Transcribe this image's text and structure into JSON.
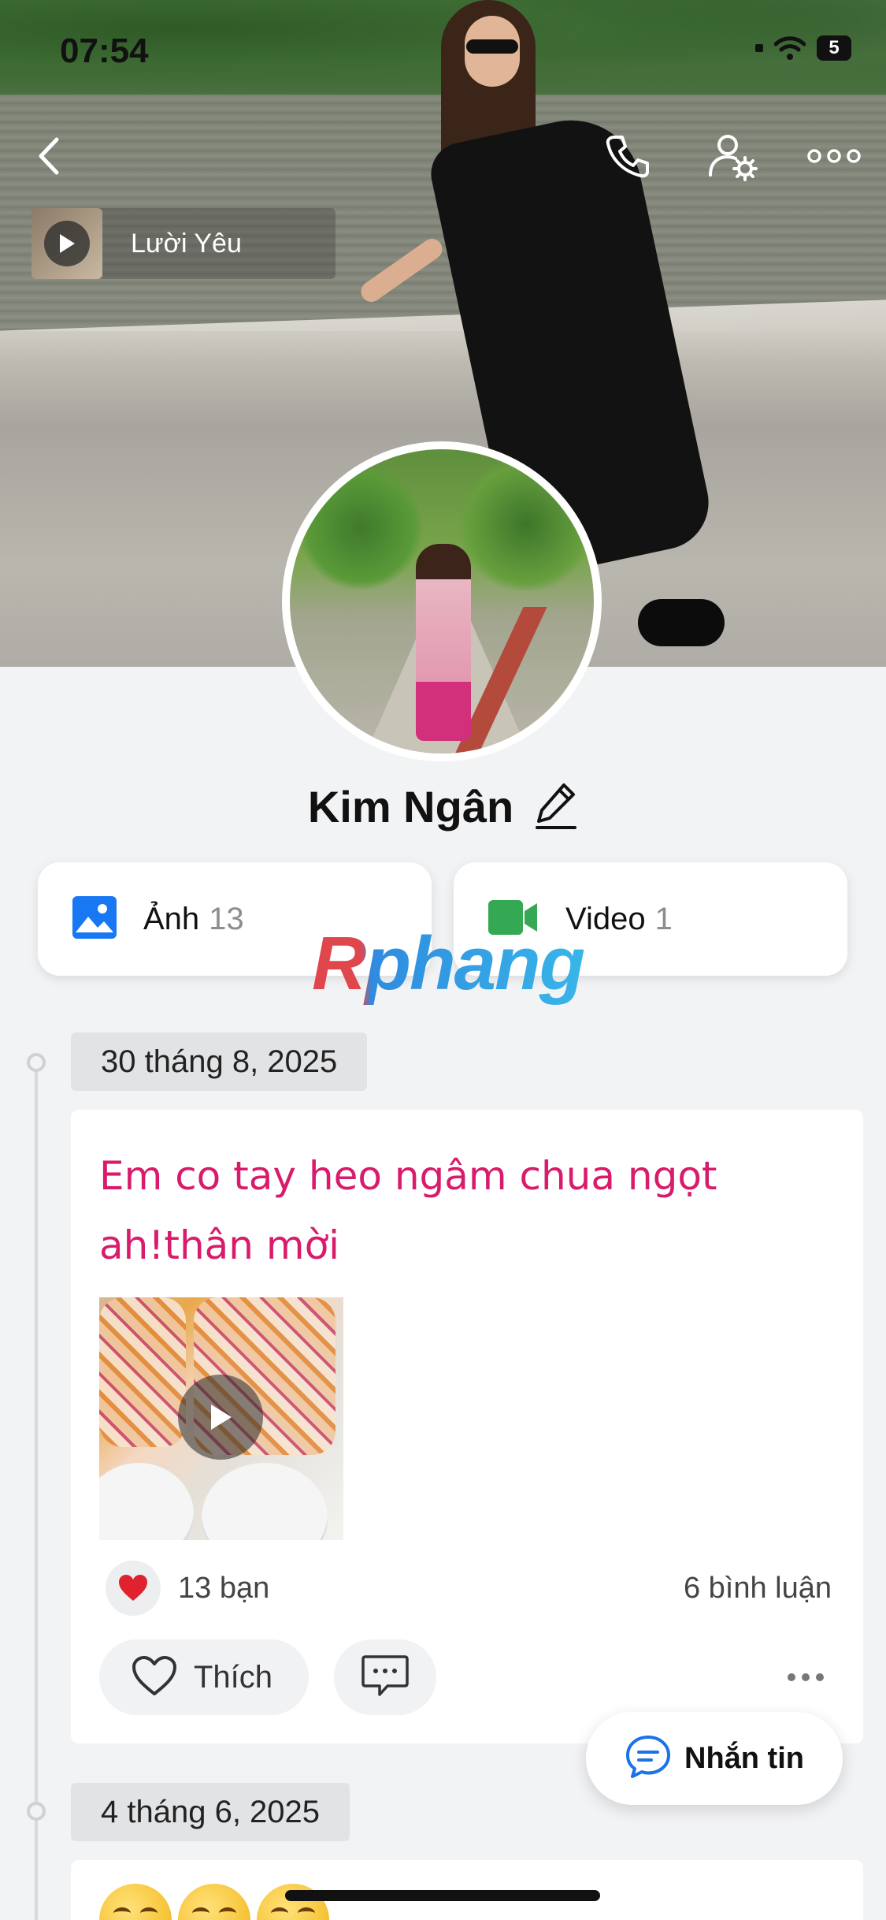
{
  "status_bar": {
    "time": "07:54",
    "battery": "5"
  },
  "cover": {
    "music_title": "Lười Yêu"
  },
  "profile": {
    "name": "Kim Ngân"
  },
  "media": {
    "photos": {
      "label": "Ảnh",
      "count": "13"
    },
    "videos": {
      "label": "Video",
      "count": "1"
    }
  },
  "watermark": "Rphang",
  "timeline": [
    {
      "date": "30 tháng 8, 2025",
      "text": "Em co tay heo ngâm chua ngọt ah!thân mời",
      "reactions": "13 bạn",
      "comments": "6 bình luận",
      "like_label": "Thích"
    },
    {
      "date": "4 tháng 6, 2025"
    }
  ],
  "fab": {
    "label": "Nhắn tin"
  },
  "colors": {
    "post_text": "#d81b6a",
    "photo_icon": "#1877f2",
    "video_icon": "#34a853",
    "message_icon": "#1a73e8"
  }
}
